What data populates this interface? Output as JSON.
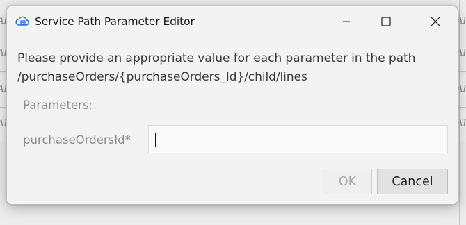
{
  "background": {
    "cell_fragments": [
      "AI",
      "AI",
      "AI"
    ]
  },
  "dialog": {
    "title": "Service Path Parameter Editor",
    "app_icon": "cloud-icon",
    "window_controls": [
      "minimize-icon",
      "maximize-icon",
      "close-icon"
    ],
    "message_line1": "Please provide an appropriate value for each parameter in the path",
    "message_line2": "/purchaseOrders/{purchaseOrders_Id}/child/lines",
    "parameters_heading": "Parameters:",
    "parameters": [
      {
        "label": "purchaseOrdersId*",
        "value": "",
        "required": true
      }
    ],
    "buttons": {
      "ok_label": "OK",
      "ok_enabled": false,
      "cancel_label": "Cancel"
    }
  },
  "colors": {
    "dialog_background": "#f3f3f3",
    "text_primary": "#3a3a3a",
    "label_muted": "#8a8a8a",
    "icon_accent": "#2f6fd0"
  }
}
